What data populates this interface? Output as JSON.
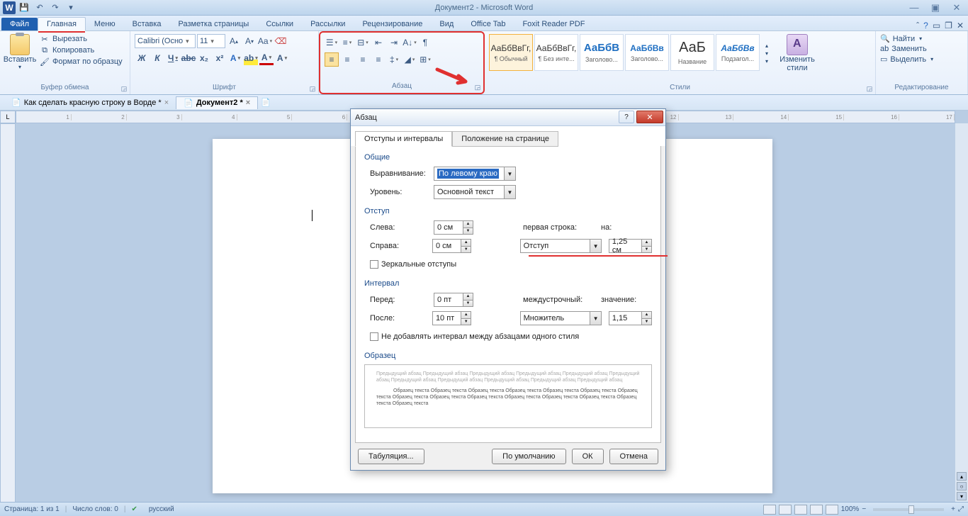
{
  "window": {
    "title": "Документ2 - Microsoft Word"
  },
  "ribbon_tabs": {
    "file": "Файл",
    "home": "Главная",
    "menu": "Меню",
    "insert": "Вставка",
    "layout": "Разметка страницы",
    "references": "Ссылки",
    "mailings": "Рассылки",
    "review": "Рецензирование",
    "view": "Вид",
    "officetab": "Office Tab",
    "foxit": "Foxit Reader PDF"
  },
  "clipboard": {
    "paste": "Вставить",
    "cut": "Вырезать",
    "copy": "Копировать",
    "format_painter": "Формат по образцу",
    "label": "Буфер обмена"
  },
  "font": {
    "name": "Calibri (Осно",
    "size": "11",
    "label": "Шрифт"
  },
  "paragraph": {
    "label": "Абзац"
  },
  "styles": {
    "label": "Стили",
    "change": "Изменить стили",
    "items": [
      {
        "preview": "АаБбВвГг,",
        "name": "¶ Обычный"
      },
      {
        "preview": "АаБбВвГг,",
        "name": "¶ Без инте..."
      },
      {
        "preview": "АаБбВ",
        "name": "Заголово..."
      },
      {
        "preview": "АаБбВв",
        "name": "Заголово..."
      },
      {
        "preview": "АаБ",
        "name": "Название"
      },
      {
        "preview": "АаБбВв",
        "name": "Подзагол..."
      }
    ]
  },
  "editing": {
    "find": "Найти",
    "replace": "Заменить",
    "select": "Выделить",
    "label": "Редактирование"
  },
  "doctabs": {
    "tab1": "Как сделать красную строку в Ворде *",
    "tab2": "Документ2 *"
  },
  "dialog": {
    "title": "Абзац",
    "tab1": "Отступы и интервалы",
    "tab2": "Положение на странице",
    "sec_general": "Общие",
    "alignment_label": "Выравнивание:",
    "alignment_value": "По левому краю",
    "level_label": "Уровень:",
    "level_value": "Основной текст",
    "sec_indent": "Отступ",
    "left_label": "Слева:",
    "left_value": "0 см",
    "right_label": "Справа:",
    "right_value": "0 см",
    "firstline_label": "первая строка:",
    "firstline_value": "Отступ",
    "by_label": "на:",
    "by_value": "1,25 см",
    "mirror": "Зеркальные отступы",
    "sec_spacing": "Интервал",
    "before_label": "Перед:",
    "before_value": "0 пт",
    "after_label": "После:",
    "after_value": "10 пт",
    "linespacing_label": "междустрочный:",
    "linespacing_value": "Множитель",
    "at_label": "значение:",
    "at_value": "1,15",
    "nospace": "Не добавлять интервал между абзацами одного стиля",
    "sec_preview": "Образец",
    "prev_gray": "Предыдущий абзац Предыдущий абзац Предыдущий абзац Предыдущий абзац Предыдущий абзац Предыдущий абзац Предыдущий абзац Предыдущий абзац Предыдущий абзац Предыдущий абзац Предыдущий абзац",
    "prev_sample": "Образец текста Образец текста Образец текста Образец текста Образец текста Образец текста Образец текста Образец текста Образец текста Образец текста Образец текста Образец текста Образец текста Образец текста Образец текста",
    "btn_tabs": "Табуляция...",
    "btn_default": "По умолчанию",
    "btn_ok": "ОК",
    "btn_cancel": "Отмена"
  },
  "status": {
    "page": "Страница: 1 из 1",
    "words": "Число слов: 0",
    "lang": "русский",
    "zoom": "100%"
  }
}
